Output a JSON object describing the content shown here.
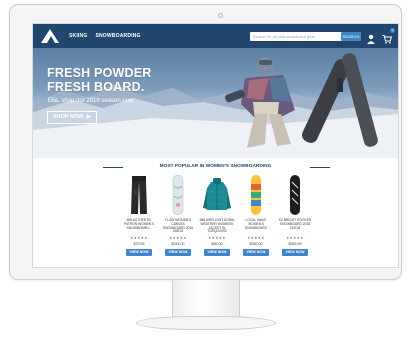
{
  "nav": {
    "links": [
      "SKIING",
      "SNOWBOARDING"
    ],
    "search_placeholder": "Search for ski and snowboard gear",
    "search_button": "SEARCH",
    "cart_count": "0"
  },
  "hero": {
    "title_line1": "FRESH POWDER",
    "title_line2": "FRESH BOARD.",
    "subtitle": "Ella, shop our 2018 season now",
    "button_label": "SHOP NOW",
    "button_arrow": "▶"
  },
  "products_section": {
    "heading": "MOST POPULAR IN WOMEN'S SNOWBOARDING",
    "items": [
      {
        "name": "686 AUTHENTIC PATRON WOMEN'S SNOWBOARD...",
        "stars": "★★★★★",
        "price": "$79.95",
        "button": "VIEW NOW"
      },
      {
        "name": "FLOW WOMEN'S CANVAS SNOWBOARD 2018 158CM",
        "stars": "★★★★★",
        "price": "$344.00",
        "button": "VIEW NOW"
      },
      {
        "name": "686 AIRFLIGHT DOWN WEATHER WOMEN'S JACKET IN TURQUOISE",
        "stars": "★★★★★",
        "price": "$95.00",
        "button": "VIEW NOW"
      },
      {
        "name": "LOCAL WAVE WOMEN'S SNOWBOARD",
        "stars": "★★★★★",
        "price": "$350.00",
        "button": "VIEW NOW"
      },
      {
        "name": "K2 BRIGHT ROCKER SNOWBOARD 2018 152CM",
        "stars": "★★★★★",
        "price": "$359.99",
        "button": "VIEW NOW"
      }
    ]
  },
  "colors": {
    "nav_bg": "#22476e",
    "accent": "#3f86c9"
  },
  "icons": [
    "mountain-logo-icon",
    "user-icon",
    "cart-icon",
    "play-arrow-icon"
  ]
}
